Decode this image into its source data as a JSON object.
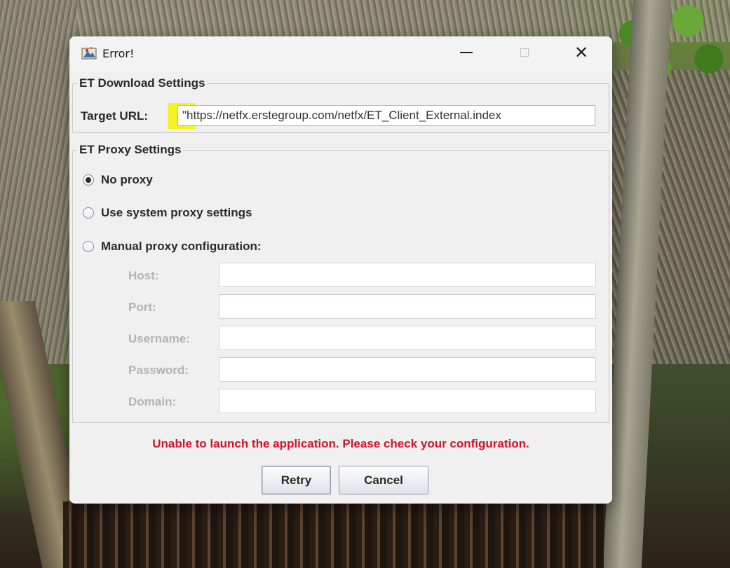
{
  "window": {
    "title": "Error!",
    "minimize_glyph": "—",
    "close_glyph": "✕"
  },
  "download_settings": {
    "group_title": "ET Download Settings",
    "target_url_label": "Target URL:",
    "target_url_value": "\"https://netfx.erstegroup.com/netfx/ET_Client_External.index"
  },
  "proxy_settings": {
    "group_title": "ET Proxy Settings",
    "options": [
      {
        "label": "No proxy",
        "selected": true
      },
      {
        "label": "Use system proxy settings",
        "selected": false
      },
      {
        "label": "Manual proxy configuration:",
        "selected": false
      }
    ],
    "fields": {
      "host_label": "Host:",
      "host_value": "",
      "port_label": "Port:",
      "port_value": "",
      "username_label": "Username:",
      "username_value": "",
      "password_label": "Password:",
      "password_value": "",
      "domain_label": "Domain:",
      "domain_value": ""
    }
  },
  "error_message": "Unable to launch the application. Please check your configuration.",
  "buttons": {
    "retry": "Retry",
    "cancel": "Cancel"
  },
  "colors": {
    "error_text": "#d0142c",
    "highlight": "#f5f20a"
  }
}
